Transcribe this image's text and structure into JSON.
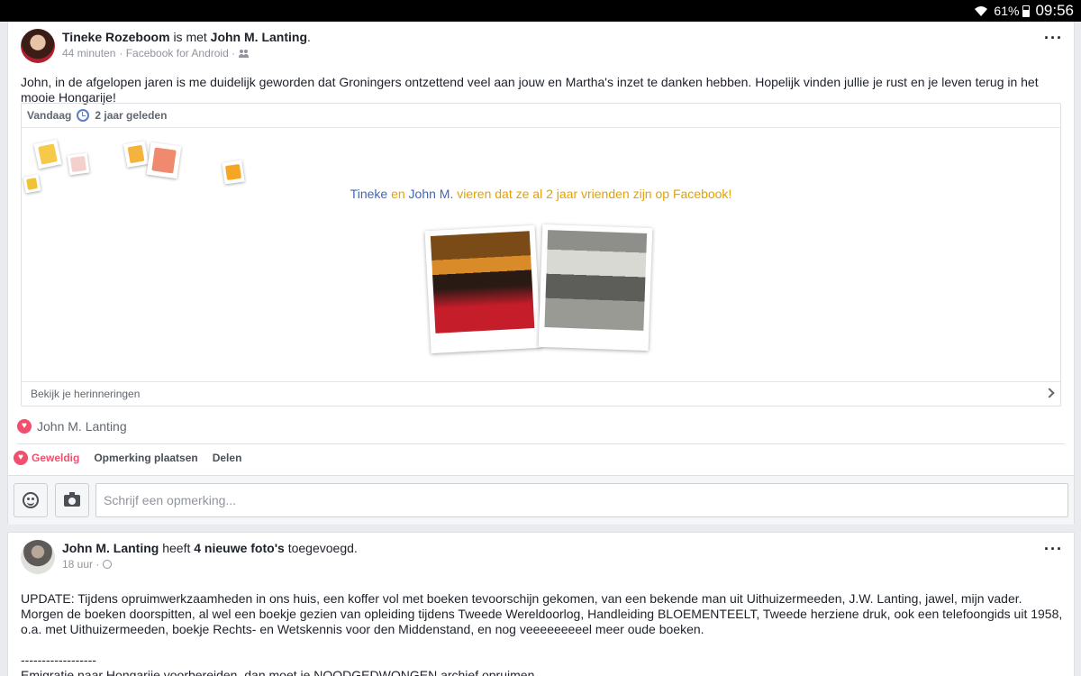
{
  "status_bar": {
    "battery": "61%",
    "time": "09:56"
  },
  "post1": {
    "author": "Tineke Rozeboom",
    "connector": "is met",
    "tagged": "John M. Lanting",
    "period": ".",
    "time": "44 minuten",
    "source": "· Facebook for Android ·",
    "text": "John, in de afgelopen jaren is me duidelijk geworden dat Groningers ontzettend veel aan jouw en Martha's inzet te danken hebben. Hopelijk vinden jullie je rust en je leven terug in het mooie Hongarije!",
    "memory": {
      "today": "Vandaag",
      "ago": "2 jaar geleden",
      "name1": "Tineke",
      "and": "en",
      "name2": "John M.",
      "celebrate": "vieren dat ze al 2 jaar vrienden zijn op Facebook!",
      "footer": "Bekijk je herinneringen"
    },
    "reaction_name": "John M. Lanting",
    "actions": {
      "like": "Geweldig",
      "comment": "Opmerking plaatsen",
      "share": "Delen"
    },
    "comment_placeholder": "Schrijf een opmerking..."
  },
  "post2": {
    "author": "John M. Lanting",
    "connector": "heeft",
    "count_label": "4 nieuwe foto's",
    "suffix": "toegevoegd.",
    "time": "18 uur ·",
    "lines": [
      "UPDATE: Tijdens opruimwerkzaamheden in ons huis, een koffer vol met boeken tevoorschijn gekomen, van een bekende man uit Uithuizermeeden, J.W. Lanting, jawel, mijn vader.",
      "Morgen de boeken doorspitten, al wel een boekje gezien van opleiding tijdens Tweede Wereldoorlog, Handleiding BLOEMENTEELT, Tweede herziene druk, ook een telefoongids uit 1958, o.a. met Uithuizermeeden, boekje Rechts- en Wetskennis voor den Middenstand, en nog veeeeeeeeel meer oude boeken.",
      "------------------",
      "Emigratie naar Hongarije voorbereiden, dan moet je NOODGEDWONGEN archief opruimen....."
    ]
  },
  "colors": {
    "link_blue": "#4267b2",
    "memory_orange": "#e2a300",
    "heart_red": "#f0506e"
  }
}
